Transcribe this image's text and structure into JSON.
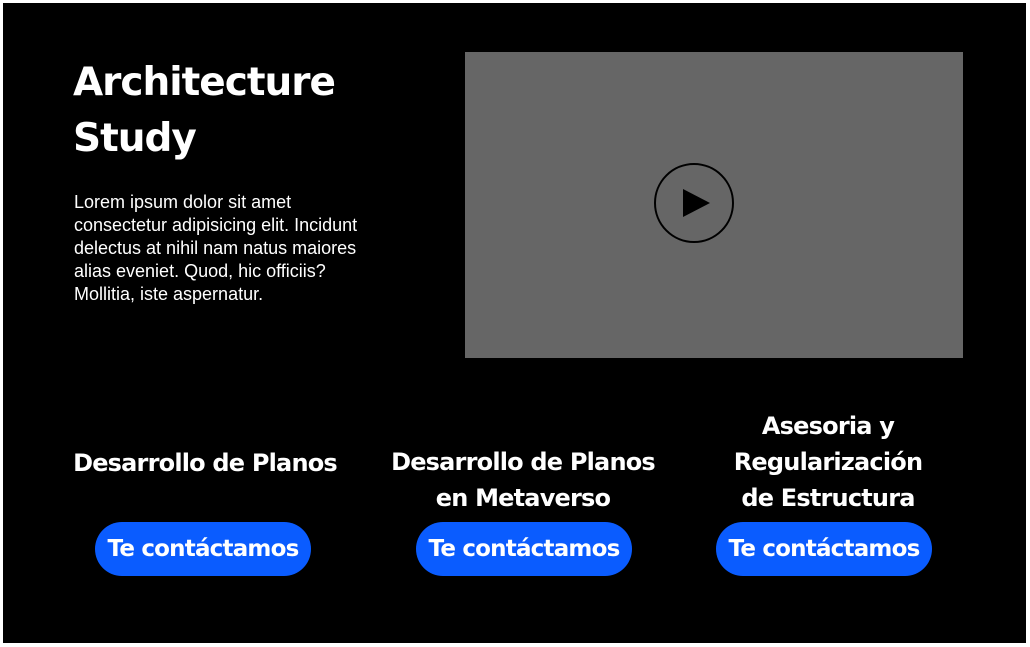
{
  "hero": {
    "title_line1": "Architecture",
    "title_line2": "Study",
    "description": "Lorem ipsum dolor sit amet consectetur adipisicing elit. Incidunt delectus at nihil nam natus maiores alias eveniet. Quod, hic officiis? Mollitia, iste aspernatur."
  },
  "video": {
    "icon": "play-icon",
    "background_color": "#666666"
  },
  "services": [
    {
      "title_lines": [
        "Desarrollo de Planos"
      ],
      "button_label": "Te contáctamos"
    },
    {
      "title_lines": [
        "Desarrollo de Planos",
        "en Metaverso"
      ],
      "button_label": "Te contáctamos"
    },
    {
      "title_lines": [
        "Asesoria y",
        "Regularización",
        "de Estructura"
      ],
      "button_label": "Te contáctamos"
    }
  ],
  "colors": {
    "background": "#000000",
    "accent": "#0a5cff",
    "text": "#ffffff"
  }
}
